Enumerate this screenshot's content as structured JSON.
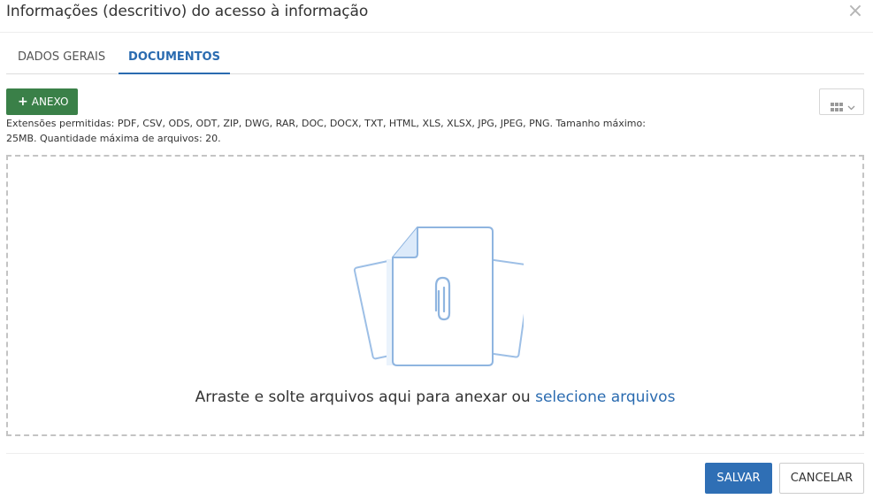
{
  "dialog": {
    "title": "Informações (descritivo) do acesso à informação",
    "close_icon": "close-icon"
  },
  "tabs": [
    {
      "label": "DADOS GERAIS",
      "active": false
    },
    {
      "label": "DOCUMENTOS",
      "active": true
    }
  ],
  "toolbar": {
    "anexo_label": "ANEXO",
    "anexo_icon": "plus-icon",
    "view_toggle_icon": "grid-view-icon",
    "view_toggle_chevron": "chevron-down-icon"
  },
  "help_text": "Extensões permitidas: PDF, CSV, ODS, ODT, ZIP, DWG, RAR, DOC, DOCX, TXT, HTML, XLS, XLSX, JPG, JPEG, PNG. Tamanho máximo: 25MB. Quantidade máxima de arquivos: 20.",
  "dropzone": {
    "illustration_icon": "paperclip-document-icon",
    "text": "Arraste e solte arquivos aqui para anexar ou",
    "link_text": "selecione arquivos"
  },
  "footer": {
    "save_label": "SALVAR",
    "cancel_label": "CANCELAR"
  },
  "colors": {
    "primary": "#2f6fb5",
    "success": "#3a8048",
    "active_tab": "#2a6bb0",
    "illustration": "#8fb5e0"
  }
}
